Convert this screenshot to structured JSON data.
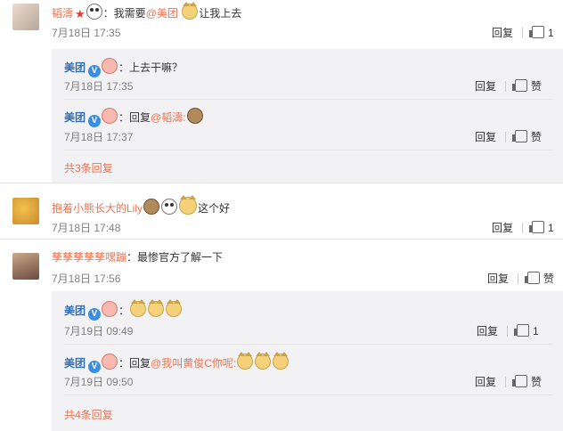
{
  "comments": [
    {
      "author": "韬濤",
      "text_prefix": "：我需要",
      "mention": "@美团",
      "text_suffix": "让我上去",
      "time": "7月18日 17:35",
      "reply_label": "回复",
      "like_count": "1"
    },
    {
      "author": "抱着小熊长大的Lily",
      "text": "这个好",
      "time": "7月18日 17:48",
      "reply_label": "回复",
      "like_count": "1"
    },
    {
      "author": "孳孳孳孳孳嘿蹦",
      "text": "：最惨官方了解一下",
      "time": "7月18日 17:56",
      "reply_label": "回复",
      "like_label": "赞"
    }
  ],
  "replies_group_1": [
    {
      "author": "美团",
      "text": "：上去干嘛？",
      "time": "7月18日 17:35",
      "reply_label": "回复",
      "like_label": "赞"
    },
    {
      "author": "美团",
      "text_prefix": "：回复",
      "mention": "@韬濤",
      "text_suffix": ":",
      "time": "7月18日 17:37",
      "reply_label": "回复",
      "like_label": "赞"
    }
  ],
  "replies_group_1_more": "共3条回复",
  "replies_group_3": [
    {
      "author": "美团",
      "text": "：",
      "time": "7月19日 09:49",
      "reply_label": "回复",
      "like_count": "1"
    },
    {
      "author": "美团",
      "text_prefix": "：回复",
      "mention": "@我叫黄俊C你呢",
      "text_suffix": ":",
      "time": "7月19日 09:50",
      "reply_label": "回复",
      "like_label": "赞"
    }
  ],
  "replies_group_3_more": "共4条回复",
  "icons": {
    "verified_badge_text": "V",
    "star": "★"
  },
  "colors": {
    "link": "#eb7350",
    "verified": "#3a8de0",
    "reply_bg": "#f2f2f5"
  }
}
